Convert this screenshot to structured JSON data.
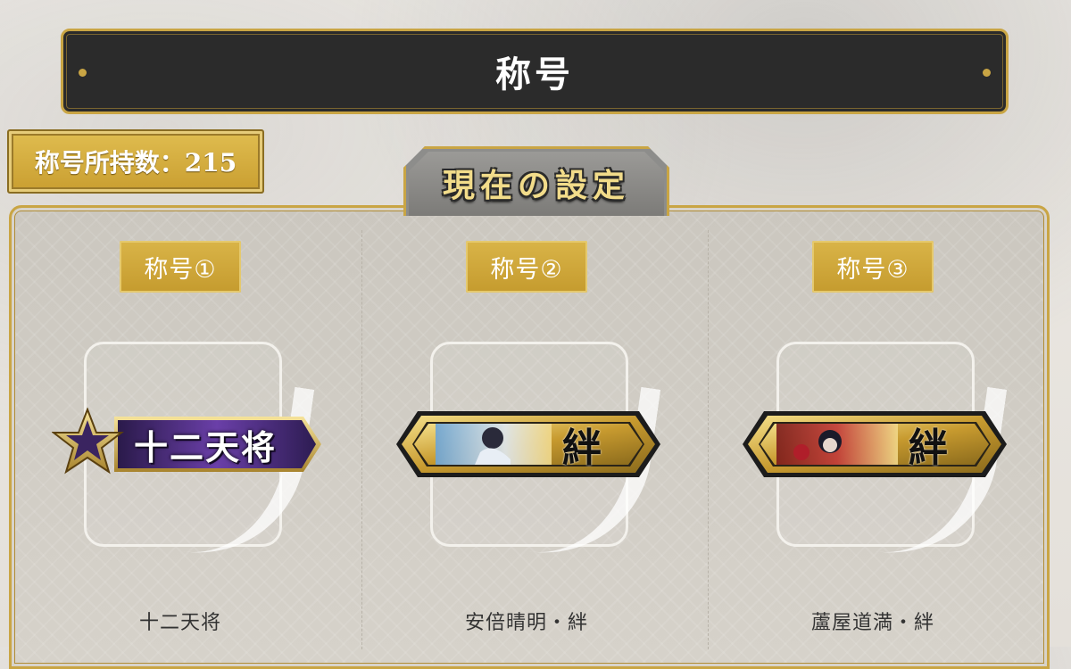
{
  "header": {
    "title": "称号"
  },
  "owned": {
    "label": "称号所持数：215"
  },
  "current_settings": {
    "tab_label": "現在の設定"
  },
  "slots": [
    {
      "badge": "称号①",
      "plate_text": "十二天将",
      "plate_style": "purple-star",
      "caption": "十二天将"
    },
    {
      "badge": "称号②",
      "plate_text": "絆",
      "plate_style": "gold-portrait",
      "caption": "安倍晴明・絆"
    },
    {
      "badge": "称号③",
      "plate_text": "絆",
      "plate_style": "gold-portrait",
      "caption": "蘆屋道満・絆"
    }
  ],
  "colors": {
    "gold": "#c9a544",
    "header_bg": "#2b2b2b",
    "plate_purple": "#4a2a7a"
  }
}
